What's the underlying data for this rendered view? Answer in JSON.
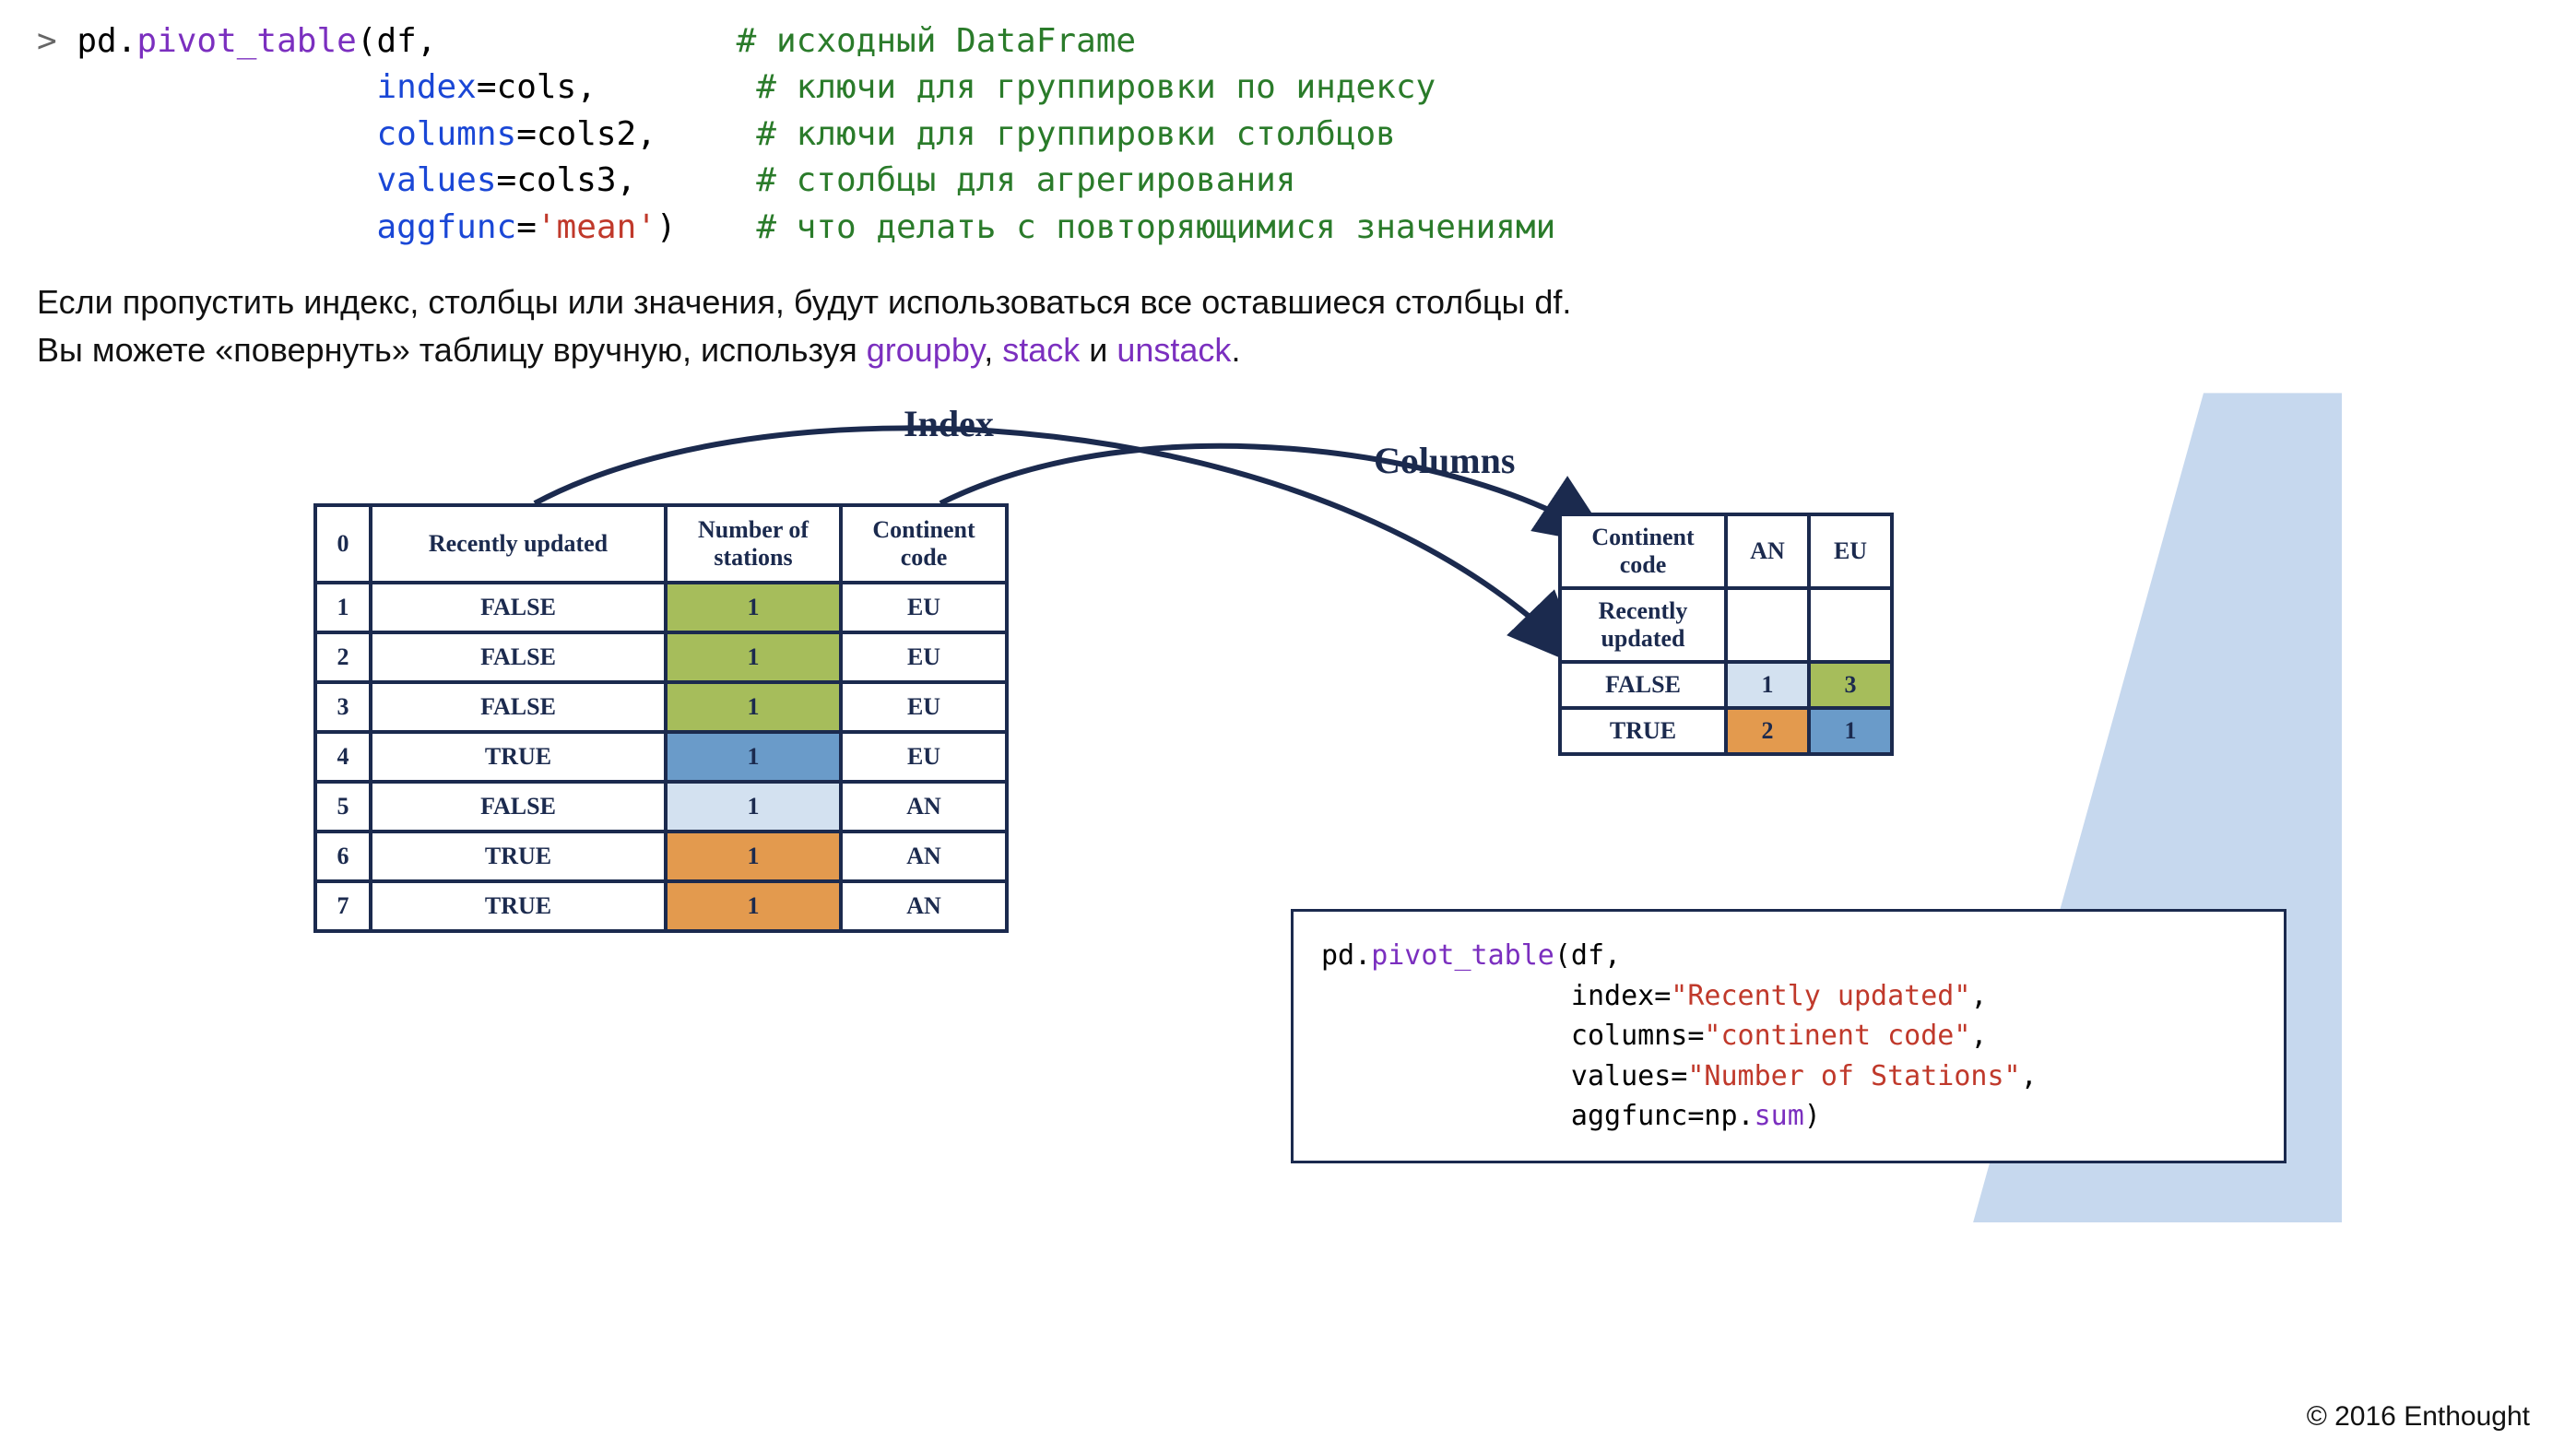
{
  "code": {
    "prompt": "> ",
    "line1_pd": "pd.",
    "line1_func": "pivot_table",
    "line1_rest": "(df,",
    "line1_cmt": "# исходный DataFrame",
    "line2_kw": "index",
    "line2_rest": "=cols,",
    "line2_cmt": "# ключи для группировки по индексу",
    "line3_kw": "columns",
    "line3_rest": "=cols2,",
    "line3_cmt": "# ключи для группировки столбцов",
    "line4_kw": "values",
    "line4_rest": "=cols3,",
    "line4_cmt": "# столбцы для агрегирования",
    "line5_kw": "aggfunc",
    "line5_eq": "=",
    "line5_str": "'mean'",
    "line5_close": ")",
    "line5_cmt": "# что делать с повторяющимися значениями"
  },
  "desc": {
    "p1a": "Если пропустить индекс, столбцы или значения, будут использоваться все оставшиеся столбцы df.",
    "p2a": "Вы можете «повернуть» таблицу вручную, используя ",
    "link1": "groupby",
    "sep1": ", ",
    "link2": "stack",
    "sep2": " и ",
    "link3": "unstack",
    "end": "."
  },
  "labels": {
    "index": "Index",
    "columns": "Columns"
  },
  "src": {
    "h0": "0",
    "h1": "Recently updated",
    "h2": "Number of\nstations",
    "h3": "Continent\ncode",
    "rows": [
      {
        "i": "1",
        "ru": "FALSE",
        "ns": "1",
        "cc": "EU",
        "cls": "c-green"
      },
      {
        "i": "2",
        "ru": "FALSE",
        "ns": "1",
        "cc": "EU",
        "cls": "c-green"
      },
      {
        "i": "3",
        "ru": "FALSE",
        "ns": "1",
        "cc": "EU",
        "cls": "c-green"
      },
      {
        "i": "4",
        "ru": "TRUE",
        "ns": "1",
        "cc": "EU",
        "cls": "c-bluemed"
      },
      {
        "i": "5",
        "ru": "FALSE",
        "ns": "1",
        "cc": "AN",
        "cls": "c-bluelight"
      },
      {
        "i": "6",
        "ru": "TRUE",
        "ns": "1",
        "cc": "AN",
        "cls": "c-orange"
      },
      {
        "i": "7",
        "ru": "TRUE",
        "ns": "1",
        "cc": "AN",
        "cls": "c-orange"
      }
    ]
  },
  "pivot": {
    "h_cc": "Continent\ncode",
    "h_an": "AN",
    "h_eu": "EU",
    "h_ru": "Recently\nupdated",
    "rows": [
      {
        "lbl": "FALSE",
        "an": "1",
        "an_cls": "c-bluelight",
        "eu": "3",
        "eu_cls": "c-green"
      },
      {
        "lbl": "TRUE",
        "an": "2",
        "an_cls": "c-orange",
        "eu": "1",
        "eu_cls": "c-bluemed"
      }
    ]
  },
  "snippet": {
    "l1a": "pd.",
    "l1b": "pivot_table",
    "l1c": "(df,",
    "l2a": "               index=",
    "l2b": "\"Recently updated\"",
    "l2c": ",",
    "l3a": "               columns=",
    "l3b": "\"continent code\"",
    "l3c": ",",
    "l4a": "               values=",
    "l4b": "\"Number of Stations\"",
    "l4c": ",",
    "l5a": "               aggfunc=np.",
    "l5b": "sum",
    "l5c": ")"
  },
  "copyright": "© 2016 Enthought"
}
